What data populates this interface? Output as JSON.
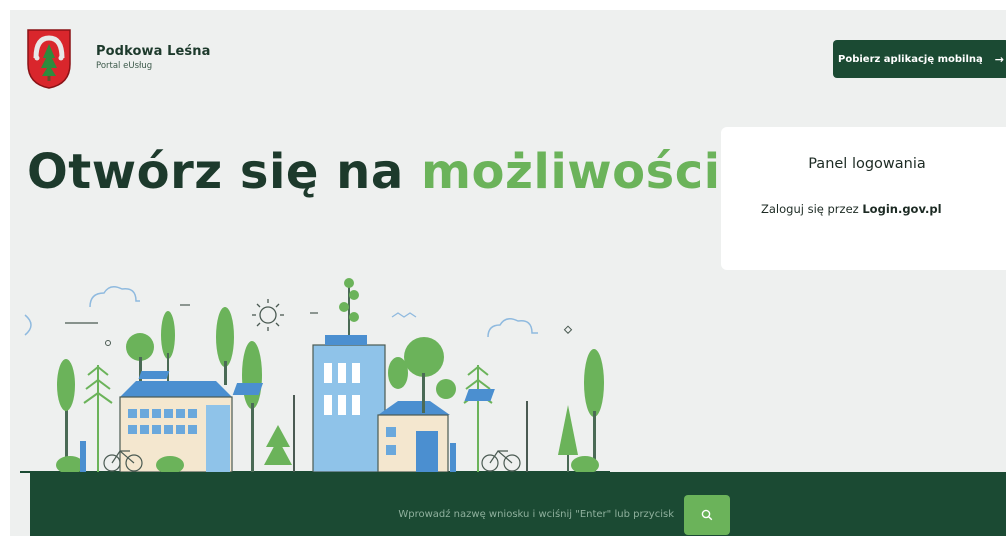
{
  "header": {
    "brand_name": "Podkowa Leśna",
    "brand_subtitle": "Portal eUsług",
    "app_button_label": "Pobierz aplikację mobilną",
    "app_button_icon": "arrow-right-icon"
  },
  "hero": {
    "title_main": "Otwórz się na",
    "title_accent": "możliwości"
  },
  "login_panel": {
    "title": "Panel logowania",
    "text_prefix": "Zaloguj się przez",
    "link_label": "Login.gov.pl"
  },
  "search": {
    "placeholder": "Wprowadź nazwę wniosku i wciśnij \"Enter\" lub przycisk",
    "button_icon": "search-icon"
  },
  "colors": {
    "dark_green": "#1b4a33",
    "accent_green": "#6bb35a",
    "background": "#eef0ef",
    "heading": "#1d3a2c"
  }
}
